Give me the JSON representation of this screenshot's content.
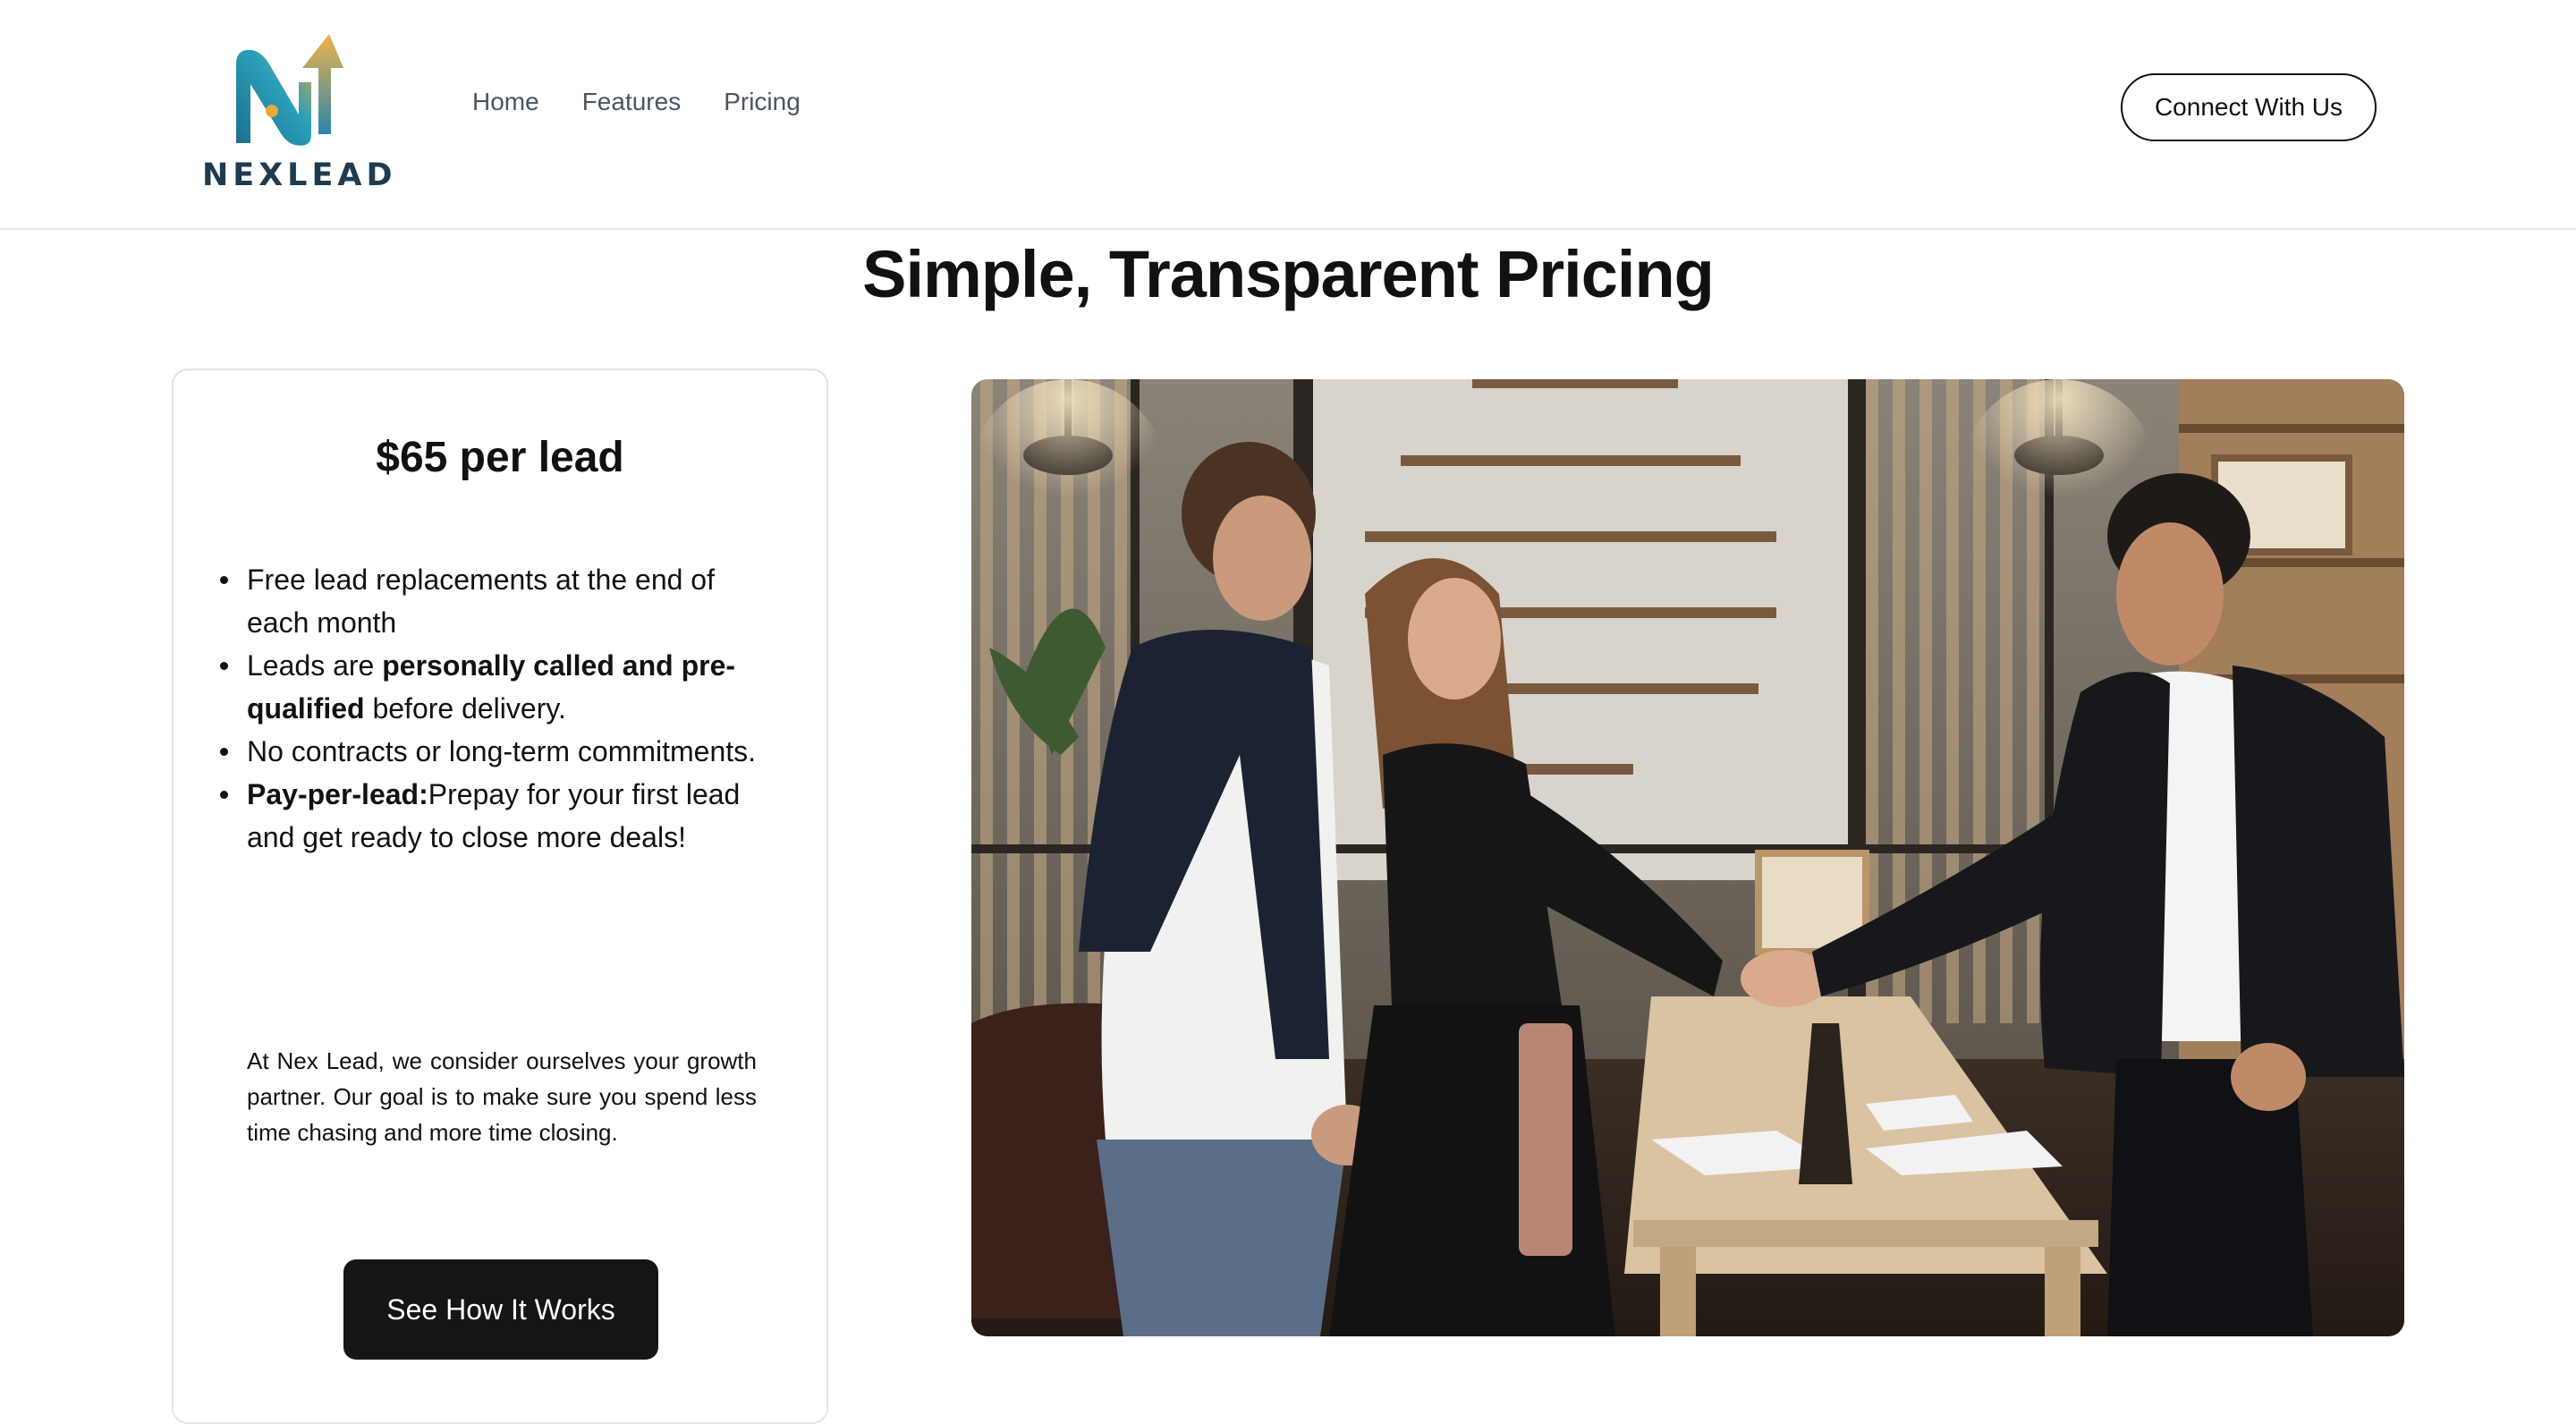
{
  "header": {
    "logo_text": "NEXLEAD",
    "nav": [
      {
        "label": "Home"
      },
      {
        "label": "Features"
      },
      {
        "label": "Pricing"
      }
    ],
    "cta_label": "Connect With Us"
  },
  "main": {
    "title": "Simple, Transparent Pricing",
    "card": {
      "price": "$65 per lead",
      "features": [
        {
          "pre": "Free lead replacements at the end of each month",
          "bold": "",
          "post": ""
        },
        {
          "pre": "Leads are ",
          "bold": "personally called and pre-qualified",
          "post": " before delivery."
        },
        {
          "pre": "No contracts or long-term commitments.",
          "bold": "",
          "post": ""
        },
        {
          "pre": "",
          "bold": "Pay-per-lead:",
          "post": "Prepay for your first lead and get ready to close more deals!"
        }
      ],
      "blurb": "At Nex Lead, we consider ourselves your growth partner. Our goal is to make sure you spend less time chasing and more time closing.",
      "button_label": "See How It Works"
    }
  },
  "icons": {
    "logo": "nexlead-logo-icon",
    "photo": "office-handshake-photo"
  },
  "colors": {
    "primary_button": "#151515",
    "logo_teal": "#1f8fa6",
    "logo_gold": "#e9a93c",
    "logo_text": "#1f3b4f"
  }
}
